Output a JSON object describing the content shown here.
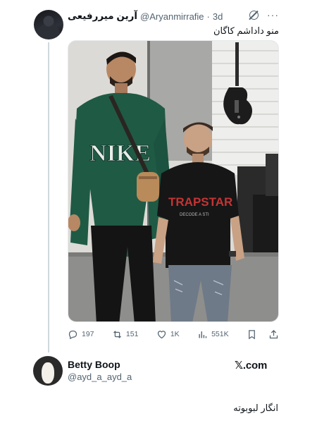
{
  "tweet": {
    "author_name": "آرین میررفیعی",
    "handle": "@Aryanmirrafie",
    "separator": "·",
    "time": "3d",
    "text": "منو داداشم کاگان",
    "photo_shirt_text_1": "NIKE",
    "photo_shirt_text_2": "TRAPSTAR",
    "photo_shirt_text_3": "DECODE A STI"
  },
  "actions": {
    "replies": "197",
    "reposts": "151",
    "likes": "1K",
    "views": "551K"
  },
  "icons": {
    "header": [
      "grok-icon",
      "more-icon"
    ],
    "actions": [
      "reply-icon",
      "repost-icon",
      "like-icon",
      "views-icon",
      "bookmark-icon",
      "share-icon"
    ]
  },
  "reply": {
    "name": "Betty Boop",
    "handle": "@ayd_a_ayd_a",
    "site": "𝕏.com",
    "text": "انگار لبوبوته"
  },
  "colors": {
    "text": "#0f1419",
    "muted": "#536471",
    "border": "#cfd9de"
  }
}
